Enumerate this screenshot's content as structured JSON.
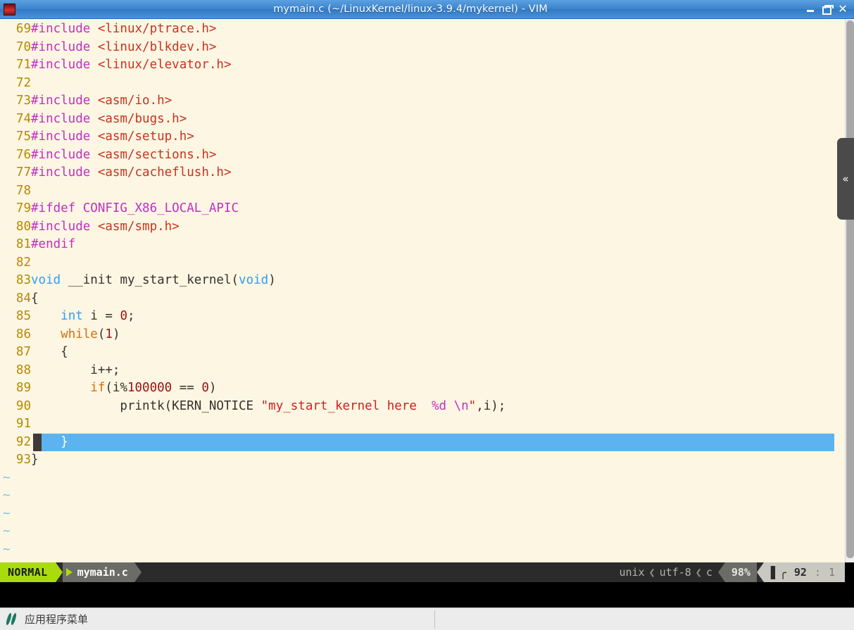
{
  "window": {
    "title": "mymain.c (~/LinuxKernel/linux-3.9.4/mykernel) - VIM",
    "app_icon": "vim-icon",
    "minimize_label": "",
    "maximize_label": "",
    "close_label": "✕"
  },
  "editor": {
    "filetype": "c",
    "lines": [
      {
        "num": "69",
        "segments": [
          {
            "t": "#include ",
            "c": "c-pre"
          },
          {
            "t": "<linux/ptrace.h>",
            "c": "c-hdr"
          }
        ]
      },
      {
        "num": "70",
        "segments": [
          {
            "t": "#include ",
            "c": "c-pre"
          },
          {
            "t": "<linux/blkdev.h>",
            "c": "c-hdr"
          }
        ]
      },
      {
        "num": "71",
        "segments": [
          {
            "t": "#include ",
            "c": "c-pre"
          },
          {
            "t": "<linux/elevator.h>",
            "c": "c-hdr"
          }
        ]
      },
      {
        "num": "72",
        "segments": []
      },
      {
        "num": "73",
        "segments": [
          {
            "t": "#include ",
            "c": "c-pre"
          },
          {
            "t": "<asm/io.h>",
            "c": "c-hdr"
          }
        ]
      },
      {
        "num": "74",
        "segments": [
          {
            "t": "#include ",
            "c": "c-pre"
          },
          {
            "t": "<asm/bugs.h>",
            "c": "c-hdr"
          }
        ]
      },
      {
        "num": "75",
        "segments": [
          {
            "t": "#include ",
            "c": "c-pre"
          },
          {
            "t": "<asm/setup.h>",
            "c": "c-hdr"
          }
        ]
      },
      {
        "num": "76",
        "segments": [
          {
            "t": "#include ",
            "c": "c-pre"
          },
          {
            "t": "<asm/sections.h>",
            "c": "c-hdr"
          }
        ]
      },
      {
        "num": "77",
        "segments": [
          {
            "t": "#include ",
            "c": "c-pre"
          },
          {
            "t": "<asm/cacheflush.h>",
            "c": "c-hdr"
          }
        ]
      },
      {
        "num": "78",
        "segments": []
      },
      {
        "num": "79",
        "segments": [
          {
            "t": "#ifdef CONFIG_X86_LOCAL_APIC",
            "c": "c-pre"
          }
        ]
      },
      {
        "num": "80",
        "segments": [
          {
            "t": "#include ",
            "c": "c-pre"
          },
          {
            "t": "<asm/smp.h>",
            "c": "c-hdr"
          }
        ]
      },
      {
        "num": "81",
        "segments": [
          {
            "t": "#endif",
            "c": "c-pre"
          }
        ]
      },
      {
        "num": "82",
        "segments": []
      },
      {
        "num": "83",
        "segments": [
          {
            "t": "void",
            "c": "c-type"
          },
          {
            "t": " __init my_start_kernel(",
            "c": "c-id"
          },
          {
            "t": "void",
            "c": "c-type"
          },
          {
            "t": ")",
            "c": "c-id"
          }
        ]
      },
      {
        "num": "84",
        "segments": [
          {
            "t": "{",
            "c": "c-id"
          }
        ]
      },
      {
        "num": "85",
        "segments": [
          {
            "t": "    ",
            "c": "c-id"
          },
          {
            "t": "int",
            "c": "c-type"
          },
          {
            "t": " i = ",
            "c": "c-id"
          },
          {
            "t": "0",
            "c": "c-num"
          },
          {
            "t": ";",
            "c": "c-id"
          }
        ]
      },
      {
        "num": "86",
        "segments": [
          {
            "t": "    ",
            "c": "c-id"
          },
          {
            "t": "while",
            "c": "c-kw"
          },
          {
            "t": "(",
            "c": "c-id"
          },
          {
            "t": "1",
            "c": "c-num"
          },
          {
            "t": ")",
            "c": "c-id"
          }
        ]
      },
      {
        "num": "87",
        "segments": [
          {
            "t": "    {",
            "c": "c-id"
          }
        ]
      },
      {
        "num": "88",
        "segments": [
          {
            "t": "        i++;",
            "c": "c-id"
          }
        ]
      },
      {
        "num": "89",
        "segments": [
          {
            "t": "        ",
            "c": "c-id"
          },
          {
            "t": "if",
            "c": "c-kw"
          },
          {
            "t": "(i%",
            "c": "c-id"
          },
          {
            "t": "100000",
            "c": "c-num"
          },
          {
            "t": " == ",
            "c": "c-id"
          },
          {
            "t": "0",
            "c": "c-num"
          },
          {
            "t": ")",
            "c": "c-id"
          }
        ]
      },
      {
        "num": "90",
        "segments": [
          {
            "t": "            printk(KERN_NOTICE ",
            "c": "c-id"
          },
          {
            "t": "\"my_start_kernel here  ",
            "c": "c-str"
          },
          {
            "t": "%d",
            "c": "c-esc"
          },
          {
            "t": " ",
            "c": "c-str"
          },
          {
            "t": "\\n",
            "c": "c-esc"
          },
          {
            "t": "\"",
            "c": "c-str"
          },
          {
            "t": ",i);",
            "c": "c-id"
          }
        ]
      },
      {
        "num": "91",
        "segments": []
      },
      {
        "num": "92",
        "segments": [
          {
            "t": "    }",
            "c": "cl-text"
          }
        ],
        "cursor": true
      },
      {
        "num": "93",
        "segments": [
          {
            "t": "}",
            "c": "c-id"
          }
        ]
      }
    ],
    "tilde_count": 5,
    "tilde_char": "~"
  },
  "statusline": {
    "mode": "NORMAL",
    "filename": "mymain.c",
    "fileformat": "unix",
    "encoding": "utf-8",
    "filetype": "c",
    "sep_left": "❮",
    "percent": "98%",
    "line_icon": "line-number-icon",
    "line": "92",
    "colon": ":",
    "column": "1"
  },
  "scrollbar": {
    "name": "vertical-scrollbar"
  },
  "edge_panel": {
    "chevron": "«"
  },
  "taskbar": {
    "menu_icon": "whisker-menu-icon",
    "menu_label": "应用程序菜单"
  },
  "colors": {
    "titlebar": "#3c84cc",
    "editor_bg": "#fdf6e3",
    "cursor_line": "#5cb3f0",
    "mode_green": "#aadb0f",
    "linenum": "#b58900"
  }
}
